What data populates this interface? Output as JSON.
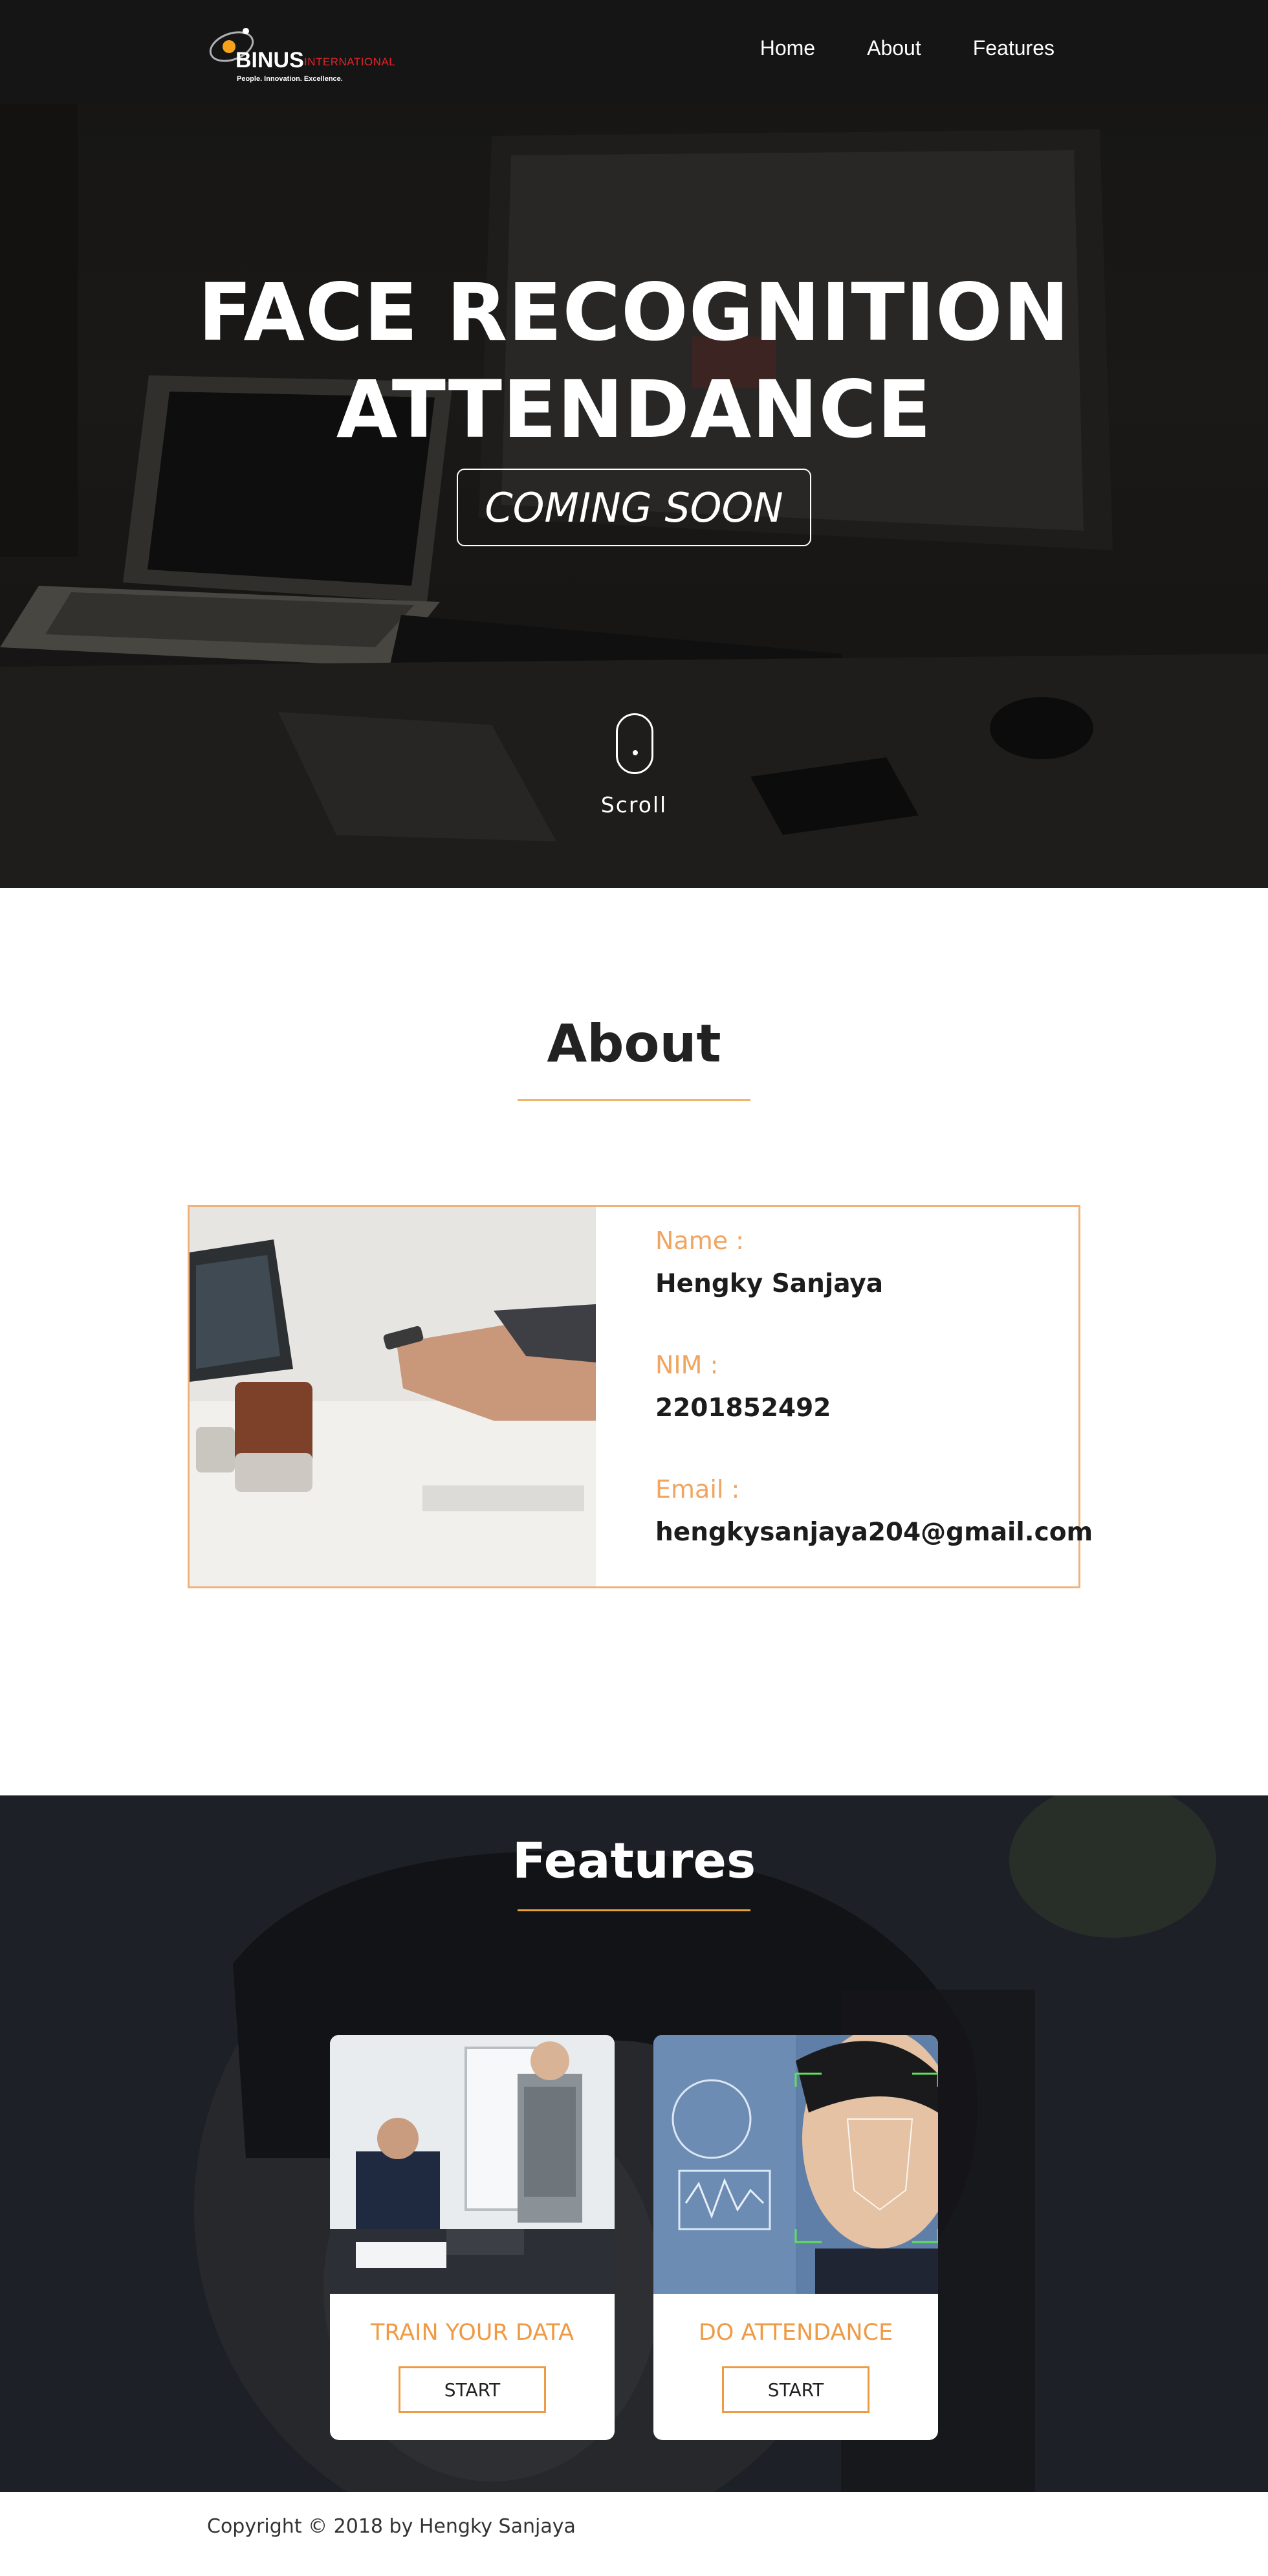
{
  "nav": {
    "logo": {
      "brand": "BINUS",
      "sub": "INTERNATIONAL",
      "tagline": "People. Innovation. Excellence."
    },
    "links": [
      "Home",
      "About",
      "Features"
    ]
  },
  "hero": {
    "title_line1": "FACE RECOGNITION",
    "title_line2": "ATTENDANCE",
    "badge": "COMING SOON",
    "scroll_label": "Scroll"
  },
  "about": {
    "heading": "About",
    "fields": [
      {
        "label": "Name :",
        "value": "Hengky Sanjaya"
      },
      {
        "label": "NIM :",
        "value": "2201852492"
      },
      {
        "label": "Email :",
        "value": "hengkysanjaya204@gmail.com"
      }
    ]
  },
  "features": {
    "heading": "Features",
    "cards": [
      {
        "title": "TRAIN YOUR DATA",
        "button": "START"
      },
      {
        "title": "DO ATTENDANCE",
        "button": "START"
      }
    ]
  },
  "footer": {
    "copyright": "Copyright © 2018 by Hengky Sanjaya"
  },
  "colors": {
    "accent": "#f0a560",
    "nav_bg": "#161616",
    "button_border": "#ef9a45"
  }
}
